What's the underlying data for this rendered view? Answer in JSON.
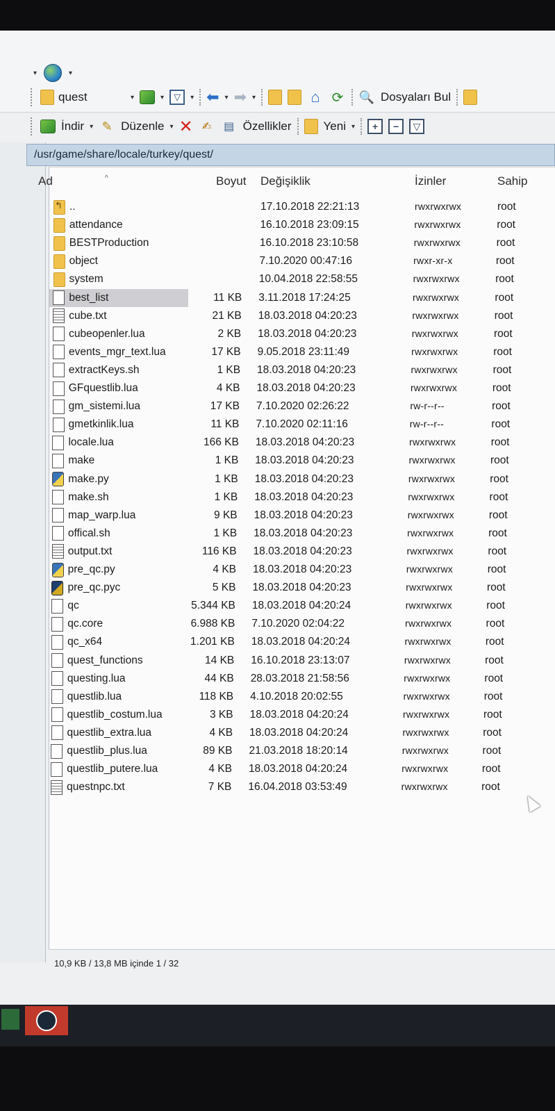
{
  "toolbar": {
    "folder_name": "quest",
    "find_files_label": "Dosyaları Bul",
    "download_label": "İndir",
    "edit_label": "Düzenle",
    "properties_label": "Özellikler",
    "new_label": "Yeni"
  },
  "path": "/usr/game/share/locale/turkey/quest/",
  "columns": {
    "name": "Ad",
    "size": "Boyut",
    "modified": "Değişiklik",
    "permissions": "İzinler",
    "owner": "Sahip"
  },
  "files": [
    {
      "name": "..",
      "icon": "folder-up-icon",
      "size": "",
      "modified": "17.10.2018 22:21:13",
      "permissions": "rwxrwxrwx",
      "owner": "root"
    },
    {
      "name": "attendance",
      "icon": "folder-icon",
      "size": "",
      "modified": "16.10.2018 23:09:15",
      "permissions": "rwxrwxrwx",
      "owner": "root"
    },
    {
      "name": "BESTProduction",
      "icon": "folder-icon",
      "size": "",
      "modified": "16.10.2018 23:10:58",
      "permissions": "rwxrwxrwx",
      "owner": "root"
    },
    {
      "name": "object",
      "icon": "folder-icon",
      "size": "",
      "modified": "7.10.2020 00:47:16",
      "permissions": "rwxr-xr-x",
      "owner": "root"
    },
    {
      "name": "system",
      "icon": "folder-icon",
      "size": "",
      "modified": "10.04.2018 22:58:55",
      "permissions": "rwxrwxrwx",
      "owner": "root"
    },
    {
      "name": "best_list",
      "icon": "file-icon",
      "size": "11 KB",
      "modified": "3.11.2018 17:24:25",
      "permissions": "rwxrwxrwx",
      "owner": "root",
      "selected": true
    },
    {
      "name": "cube.txt",
      "icon": "text-file-icon",
      "size": "21 KB",
      "modified": "18.03.2018 04:20:23",
      "permissions": "rwxrwxrwx",
      "owner": "root"
    },
    {
      "name": "cubeopenler.lua",
      "icon": "file-icon",
      "size": "2 KB",
      "modified": "18.03.2018 04:20:23",
      "permissions": "rwxrwxrwx",
      "owner": "root"
    },
    {
      "name": "events_mgr_text.lua",
      "icon": "file-icon",
      "size": "17 KB",
      "modified": "9.05.2018 23:11:49",
      "permissions": "rwxrwxrwx",
      "owner": "root"
    },
    {
      "name": "extractKeys.sh",
      "icon": "file-icon",
      "size": "1 KB",
      "modified": "18.03.2018 04:20:23",
      "permissions": "rwxrwxrwx",
      "owner": "root"
    },
    {
      "name": "GFquestlib.lua",
      "icon": "file-icon",
      "size": "4 KB",
      "modified": "18.03.2018 04:20:23",
      "permissions": "rwxrwxrwx",
      "owner": "root"
    },
    {
      "name": "gm_sistemi.lua",
      "icon": "file-icon",
      "size": "17 KB",
      "modified": "7.10.2020 02:26:22",
      "permissions": "rw-r--r--",
      "owner": "root"
    },
    {
      "name": "gmetkinlik.lua",
      "icon": "file-icon",
      "size": "11 KB",
      "modified": "7.10.2020 02:11:16",
      "permissions": "rw-r--r--",
      "owner": "root"
    },
    {
      "name": "locale.lua",
      "icon": "file-icon",
      "size": "166 KB",
      "modified": "18.03.2018 04:20:23",
      "permissions": "rwxrwxrwx",
      "owner": "root"
    },
    {
      "name": "make",
      "icon": "file-icon",
      "size": "1 KB",
      "modified": "18.03.2018 04:20:23",
      "permissions": "rwxrwxrwx",
      "owner": "root"
    },
    {
      "name": "make.py",
      "icon": "python-file-icon",
      "size": "1 KB",
      "modified": "18.03.2018 04:20:23",
      "permissions": "rwxrwxrwx",
      "owner": "root"
    },
    {
      "name": "make.sh",
      "icon": "file-icon",
      "size": "1 KB",
      "modified": "18.03.2018 04:20:23",
      "permissions": "rwxrwxrwx",
      "owner": "root"
    },
    {
      "name": "map_warp.lua",
      "icon": "file-icon",
      "size": "9 KB",
      "modified": "18.03.2018 04:20:23",
      "permissions": "rwxrwxrwx",
      "owner": "root"
    },
    {
      "name": "offical.sh",
      "icon": "file-icon",
      "size": "1 KB",
      "modified": "18.03.2018 04:20:23",
      "permissions": "rwxrwxrwx",
      "owner": "root"
    },
    {
      "name": "output.txt",
      "icon": "text-file-icon",
      "size": "116 KB",
      "modified": "18.03.2018 04:20:23",
      "permissions": "rwxrwxrwx",
      "owner": "root"
    },
    {
      "name": "pre_qc.py",
      "icon": "python-file-icon",
      "size": "4 KB",
      "modified": "18.03.2018 04:20:23",
      "permissions": "rwxrwxrwx",
      "owner": "root"
    },
    {
      "name": "pre_qc.pyc",
      "icon": "compiled-python-icon",
      "size": "5 KB",
      "modified": "18.03.2018 04:20:23",
      "permissions": "rwxrwxrwx",
      "owner": "root"
    },
    {
      "name": "qc",
      "icon": "file-icon",
      "size": "5.344 KB",
      "modified": "18.03.2018 04:20:24",
      "permissions": "rwxrwxrwx",
      "owner": "root"
    },
    {
      "name": "qc.core",
      "icon": "file-icon",
      "size": "6.988 KB",
      "modified": "7.10.2020 02:04:22",
      "permissions": "rwxrwxrwx",
      "owner": "root"
    },
    {
      "name": "qc_x64",
      "icon": "file-icon",
      "size": "1.201 KB",
      "modified": "18.03.2018 04:20:24",
      "permissions": "rwxrwxrwx",
      "owner": "root"
    },
    {
      "name": "quest_functions",
      "icon": "file-icon",
      "size": "14 KB",
      "modified": "16.10.2018 23:13:07",
      "permissions": "rwxrwxrwx",
      "owner": "root"
    },
    {
      "name": "questing.lua",
      "icon": "file-icon",
      "size": "44 KB",
      "modified": "28.03.2018 21:58:56",
      "permissions": "rwxrwxrwx",
      "owner": "root"
    },
    {
      "name": "questlib.lua",
      "icon": "file-icon",
      "size": "118 KB",
      "modified": "4.10.2018 20:02:55",
      "permissions": "rwxrwxrwx",
      "owner": "root"
    },
    {
      "name": "questlib_costum.lua",
      "icon": "file-icon",
      "size": "3 KB",
      "modified": "18.03.2018 04:20:24",
      "permissions": "rwxrwxrwx",
      "owner": "root"
    },
    {
      "name": "questlib_extra.lua",
      "icon": "file-icon",
      "size": "4 KB",
      "modified": "18.03.2018 04:20:24",
      "permissions": "rwxrwxrwx",
      "owner": "root"
    },
    {
      "name": "questlib_plus.lua",
      "icon": "file-icon",
      "size": "89 KB",
      "modified": "21.03.2018 18:20:14",
      "permissions": "rwxrwxrwx",
      "owner": "root"
    },
    {
      "name": "questlib_putere.lua",
      "icon": "file-icon",
      "size": "4 KB",
      "modified": "18.03.2018 04:20:24",
      "permissions": "rwxrwxrwx",
      "owner": "root"
    },
    {
      "name": "questnpc.txt",
      "icon": "text-file-icon",
      "size": "7 KB",
      "modified": "16.04.2018 03:53:49",
      "permissions": "rwxrwxrwx",
      "owner": "root"
    }
  ],
  "status": "10,9 KB / 13,8 MB içinde 1 / 32"
}
